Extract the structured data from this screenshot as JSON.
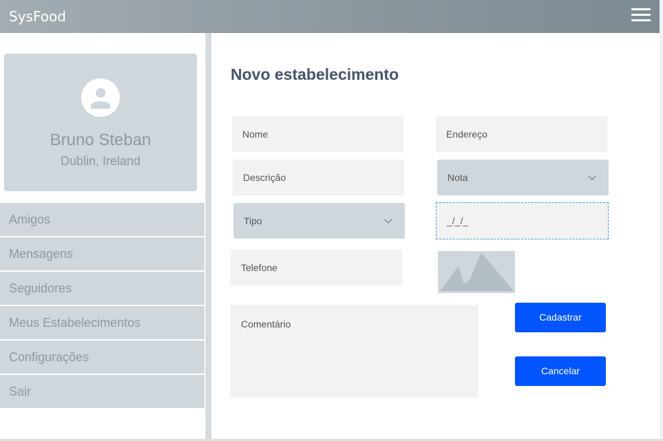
{
  "app": {
    "title": "SysFood"
  },
  "profile": {
    "name": "Bruno Steban",
    "location": "Dublin, Ireland"
  },
  "sidebar": {
    "items": [
      {
        "label": "Amigos"
      },
      {
        "label": "Mensagens"
      },
      {
        "label": "Seguidores"
      },
      {
        "label": "Meus Estabelecimentos"
      },
      {
        "label": "Configurações"
      },
      {
        "label": "Sair"
      }
    ]
  },
  "form": {
    "title": "Novo estabelecimento",
    "nome_placeholder": "Nome",
    "endereco_placeholder": "Endereço",
    "descricao_placeholder": "Descrição",
    "nota_label": "Nota",
    "tipo_label": "Tipo",
    "data_placeholder": "_/_/_",
    "telefone_placeholder": "Telefone",
    "comentario_placeholder": "Comentário",
    "cadastrar_label": "Cadastrar",
    "cancelar_label": "Cancelar"
  },
  "colors": {
    "accent": "#0055ff",
    "panel": "#cfd7dc",
    "title": "#45546a"
  },
  "icons": {
    "menu": "hamburger-menu-icon",
    "avatar": "person-icon",
    "image": "image-placeholder-icon",
    "select": "chevron-down-icon"
  }
}
